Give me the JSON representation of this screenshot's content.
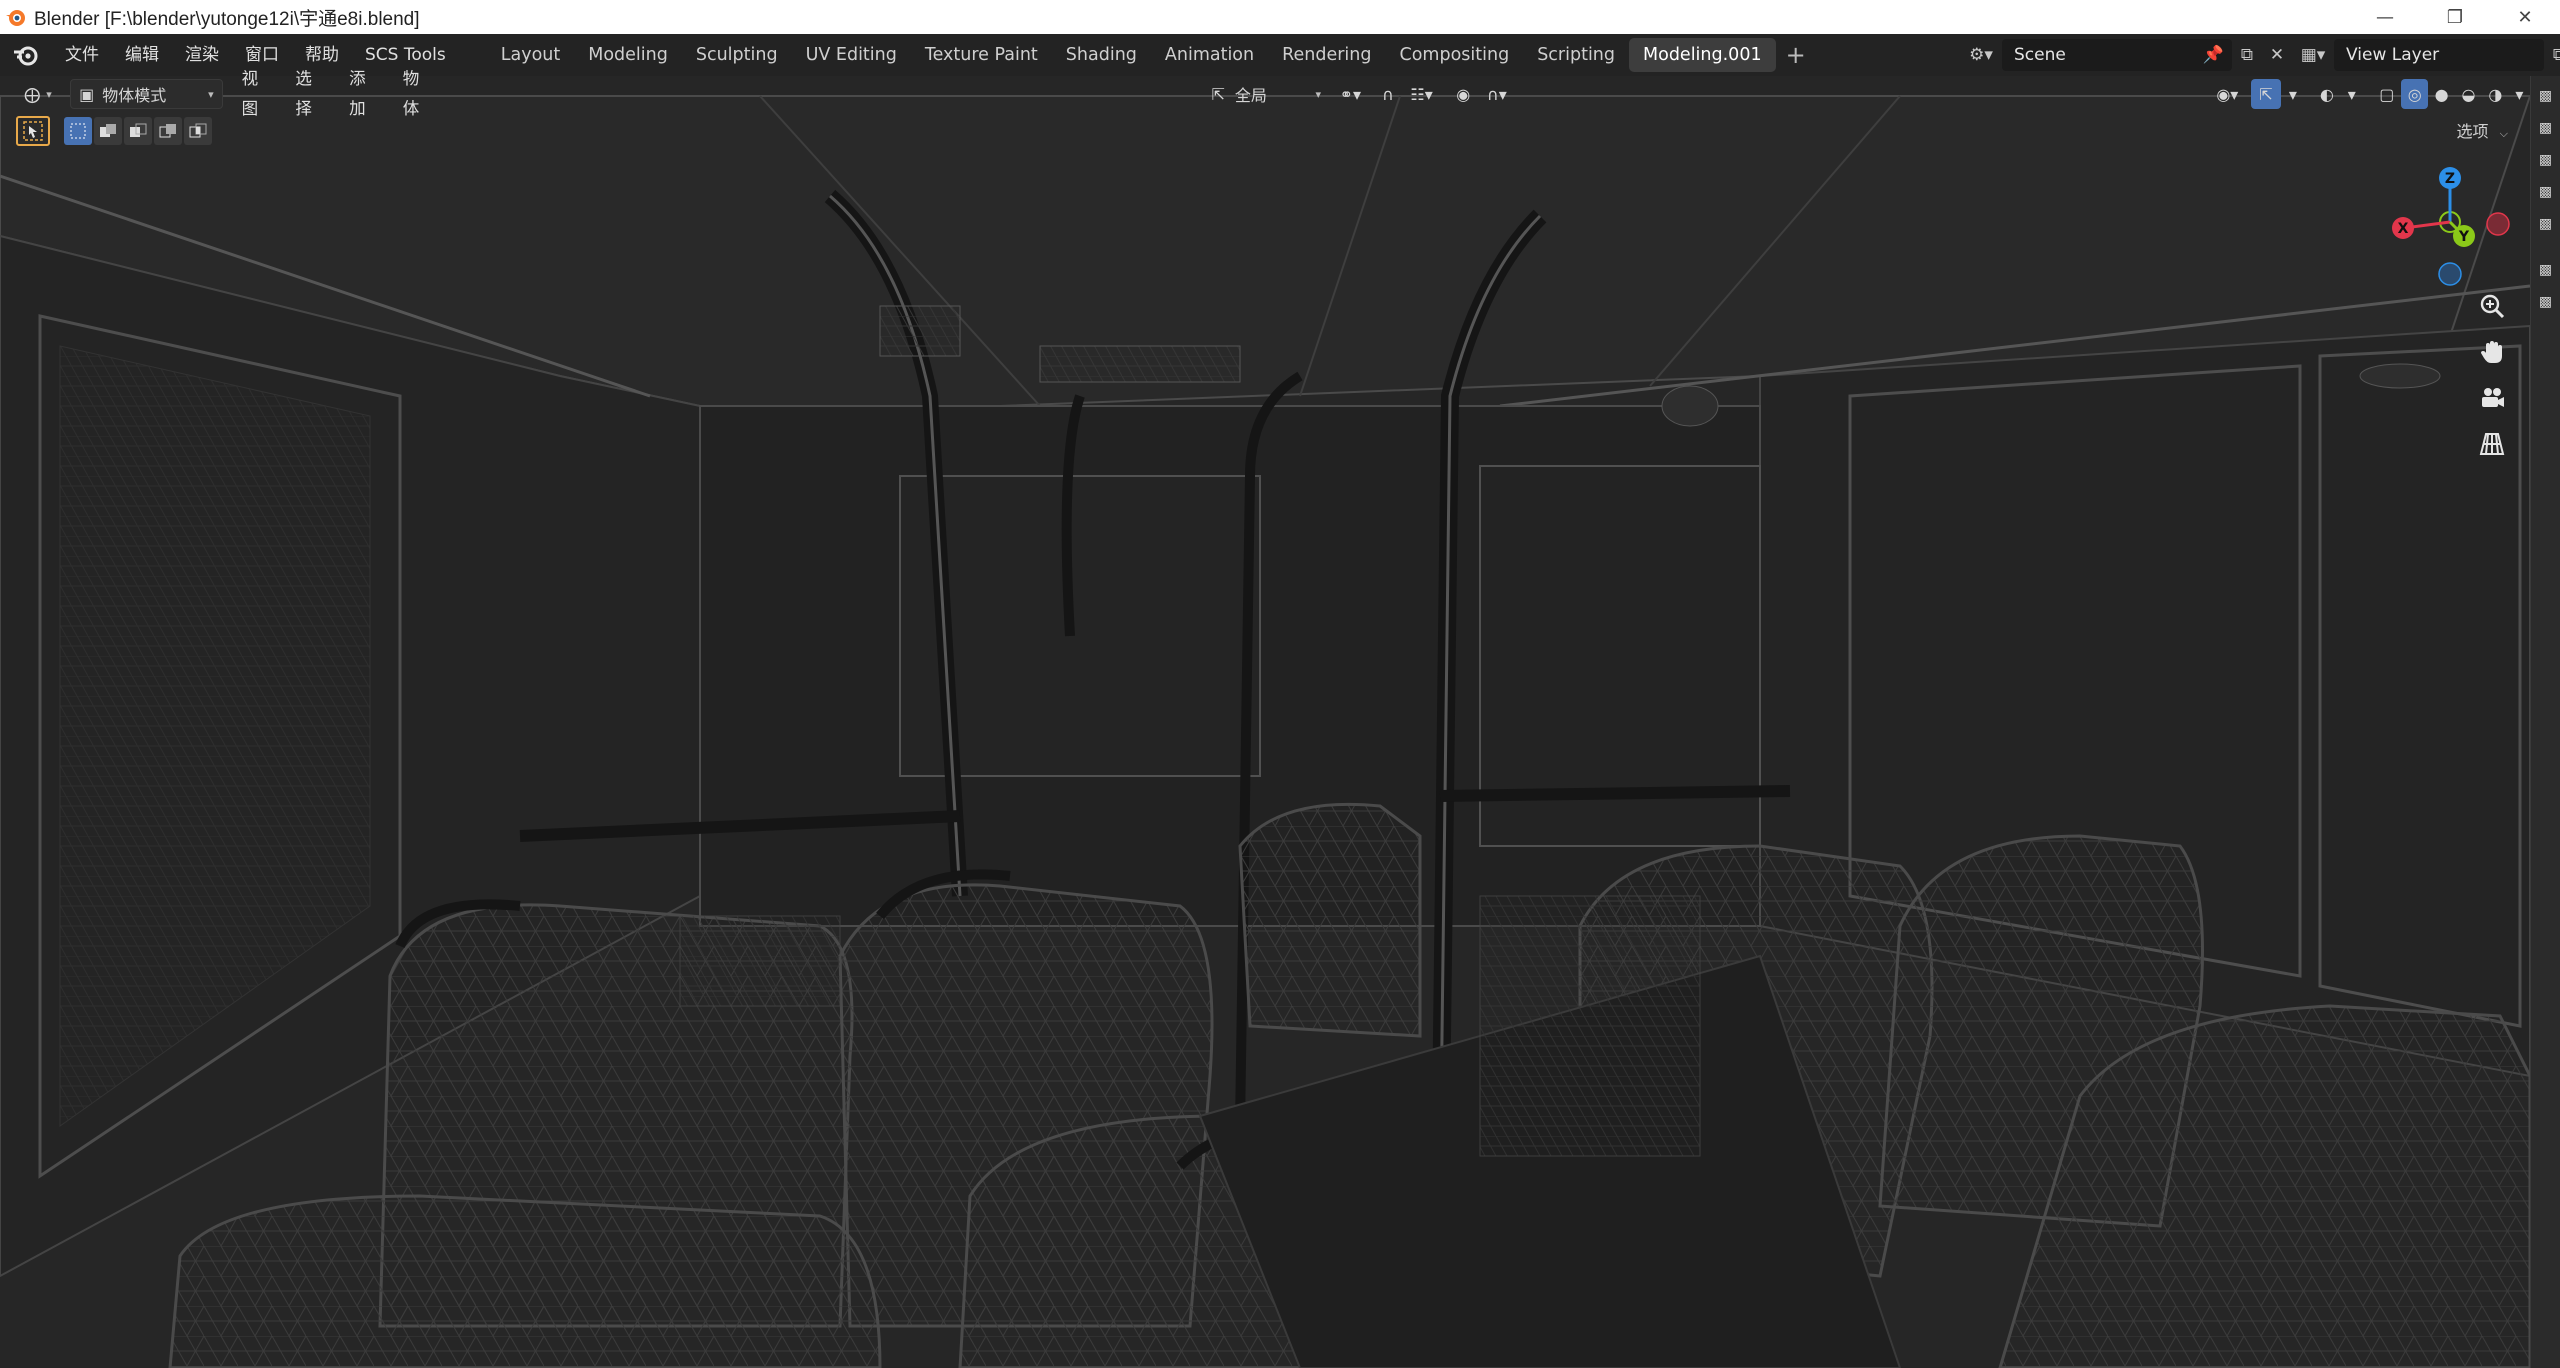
{
  "titlebar": {
    "title": "Blender [F:\\blender\\yutonge12i\\宇通e8i.blend]",
    "minimize_icon": "minimize-icon",
    "restore_icon": "restore-icon",
    "close_icon": "close-icon"
  },
  "topbar": {
    "menus": [
      "文件",
      "编辑",
      "渲染",
      "窗口",
      "帮助",
      "SCS Tools"
    ],
    "workspace_tabs": [
      "Layout",
      "Modeling",
      "Sculpting",
      "UV Editing",
      "Texture Paint",
      "Shading",
      "Animation",
      "Rendering",
      "Compositing",
      "Scripting",
      "Modeling.001"
    ],
    "active_tab": "Modeling.001",
    "add_tab": "+",
    "scene": {
      "label": "Scene"
    },
    "view_layer": {
      "label": "View Layer"
    }
  },
  "viewport_header": {
    "mode": "物体模式",
    "menus": [
      "视图",
      "选择",
      "添加",
      "物体"
    ],
    "transform_orientation": "全局",
    "options_label": "选项"
  },
  "colors": {
    "accent_blue": "#4772b3",
    "active_tool_border": "#e8a94a",
    "axis_x": "#e2364b",
    "axis_y": "#8bc919",
    "axis_z": "#2c8fe8",
    "viewport_bg": "#262626",
    "topbar_bg": "#232323"
  },
  "gizmo": {
    "axes": [
      "Z",
      "X",
      "Y"
    ]
  },
  "icons": {
    "viewport_nav": [
      "zoom-icon",
      "pan-hand-icon",
      "camera-view-icon",
      "ortho-grid-icon"
    ]
  }
}
